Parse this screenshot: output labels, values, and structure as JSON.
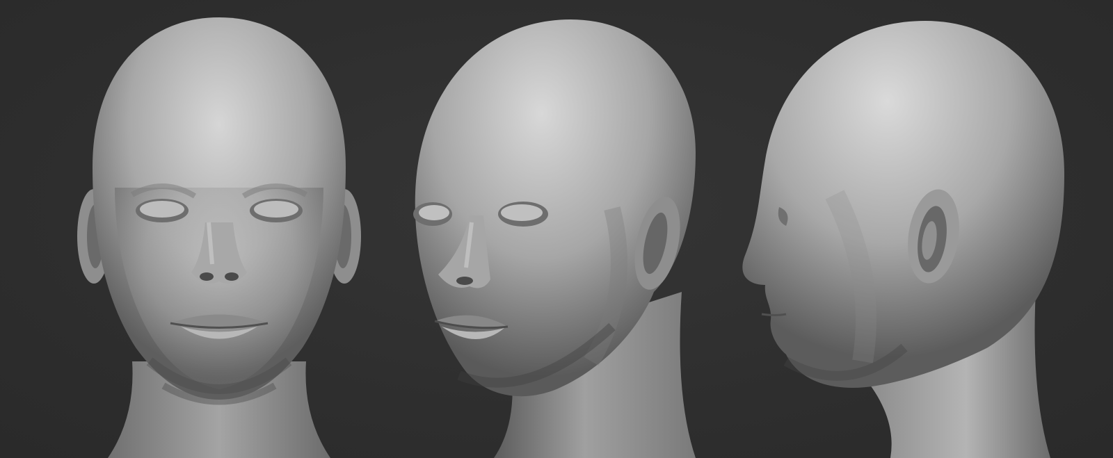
{
  "scene": {
    "background_color": "#2f2f2f",
    "material_color": "#9a9a9a",
    "highlight_color": "#d8d8d8",
    "shadow_color": "#3c3c3c",
    "views": [
      {
        "id": "front",
        "icon": "head-front-render"
      },
      {
        "id": "three-quarter",
        "icon": "head-three-quarter-render"
      },
      {
        "id": "profile",
        "icon": "head-profile-render"
      }
    ]
  }
}
